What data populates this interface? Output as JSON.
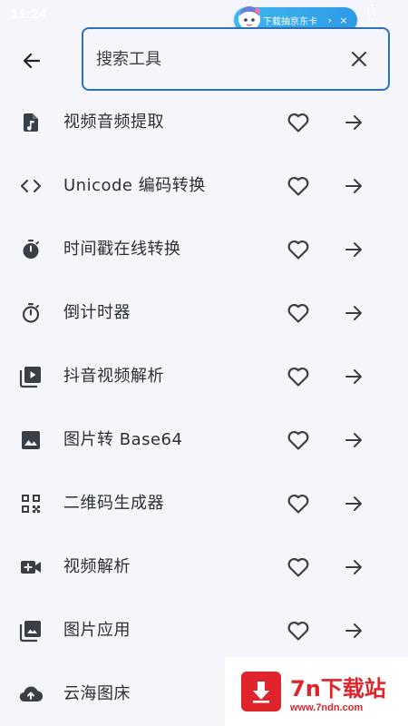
{
  "status_bar": {
    "time": "11:24"
  },
  "ad": {
    "text": "下载抽京东卡",
    "chevron": "›",
    "close": "×"
  },
  "header": {
    "back_icon": "arrow-left-icon",
    "search_placeholder": "搜索工具",
    "search_value": "",
    "clear_icon": "close-icon",
    "accent_color": "#2f6fb6"
  },
  "tools": [
    {
      "label": "视频音频提取",
      "icon": "music-file-icon"
    },
    {
      "label": "Unicode 编码转换",
      "icon": "code-icon"
    },
    {
      "label": "时间戳在线转换",
      "icon": "timer-filled-icon"
    },
    {
      "label": "倒计时器",
      "icon": "timer-outline-icon"
    },
    {
      "label": "抖音视频解析",
      "icon": "video-library-icon"
    },
    {
      "label": "图片转 Base64",
      "icon": "image-icon"
    },
    {
      "label": "二维码生成器",
      "icon": "qr-code-icon"
    },
    {
      "label": "视频解析",
      "icon": "video-camera-add-icon"
    },
    {
      "label": "图片应用",
      "icon": "photo-library-icon"
    },
    {
      "label": "云海图床",
      "icon": "cloud-upload-icon"
    }
  ],
  "row_actions": {
    "favorite_icon": "heart-outline-icon",
    "open_icon": "arrow-right-icon"
  },
  "watermark": {
    "title": "7n下载站",
    "url": "www.7ndn.com"
  }
}
